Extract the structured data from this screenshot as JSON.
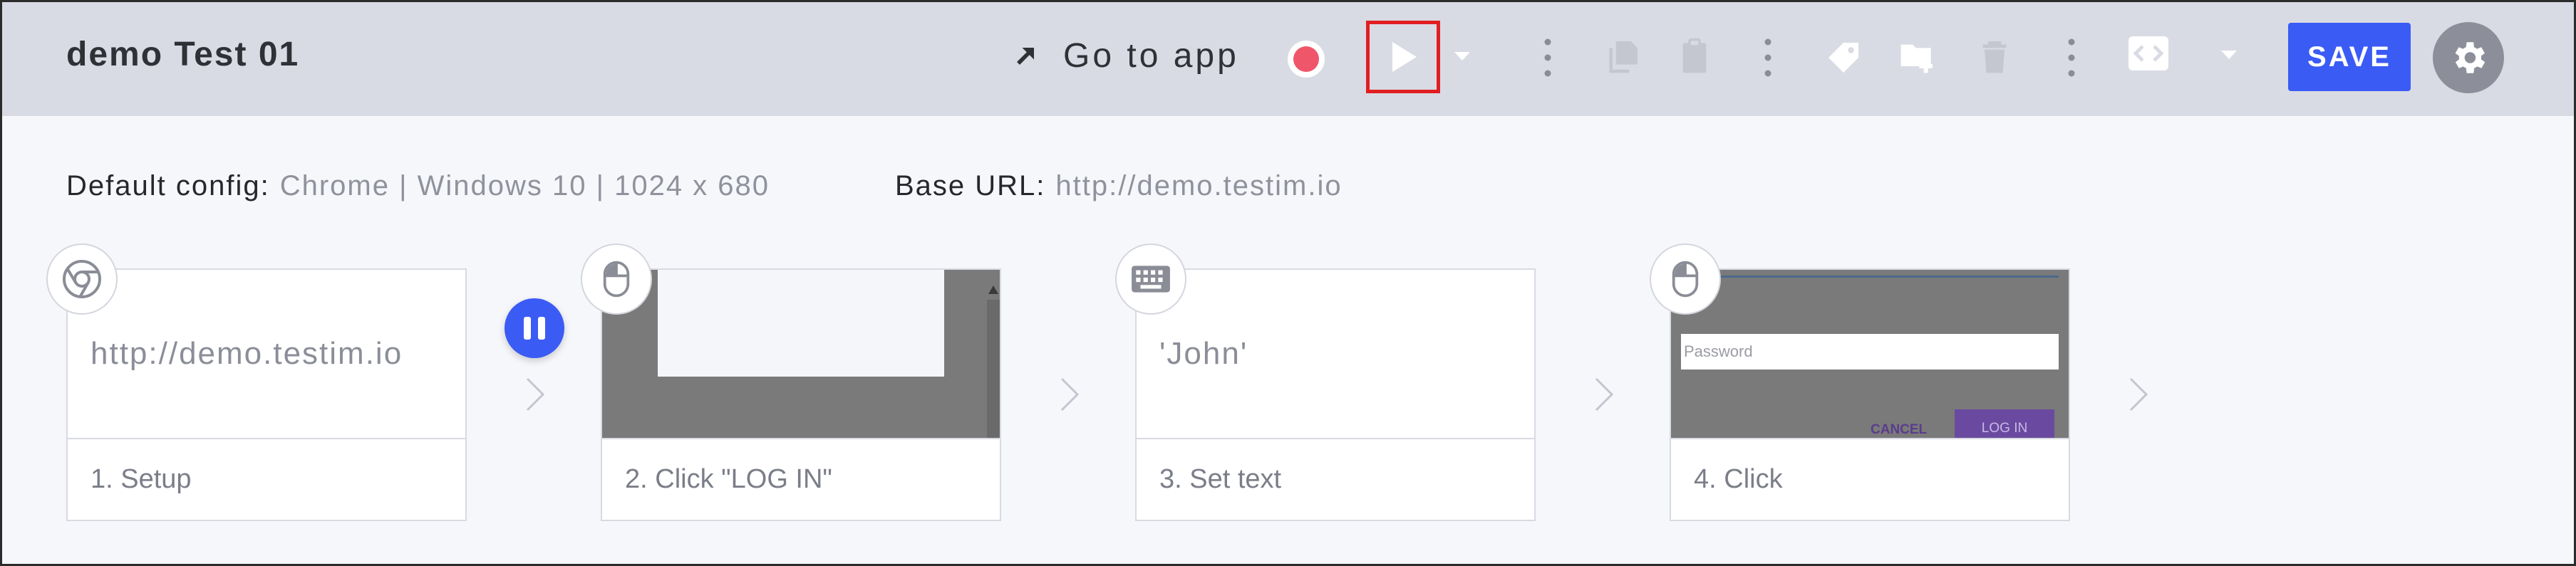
{
  "header": {
    "title": "demo Test 01",
    "go_to_app": "Go to app",
    "save_label": "SAVE"
  },
  "config": {
    "default_label": "Default config:",
    "default_value": "Chrome | Windows 10 | 1024 x 680",
    "base_url_label": "Base URL:",
    "base_url_value": "http://demo.testim.io"
  },
  "steps": [
    {
      "title": "1. Setup",
      "content": "http://demo.testim.io",
      "icon": "chrome-icon"
    },
    {
      "title": "2. Click \"LOG IN\"",
      "icon": "mouse-icon"
    },
    {
      "title": "3. Set text",
      "content": "'John'",
      "icon": "keyboard-icon"
    },
    {
      "title": "4. Click",
      "icon": "mouse-icon"
    }
  ],
  "thumbnail4": {
    "placeholder": "Password",
    "cancel": "CANCEL",
    "login": "LOG IN"
  },
  "colors": {
    "accent": "#3b5bf5",
    "record": "#f0566a",
    "highlight": "#e11e22",
    "header_bg": "#d9dbe4"
  }
}
